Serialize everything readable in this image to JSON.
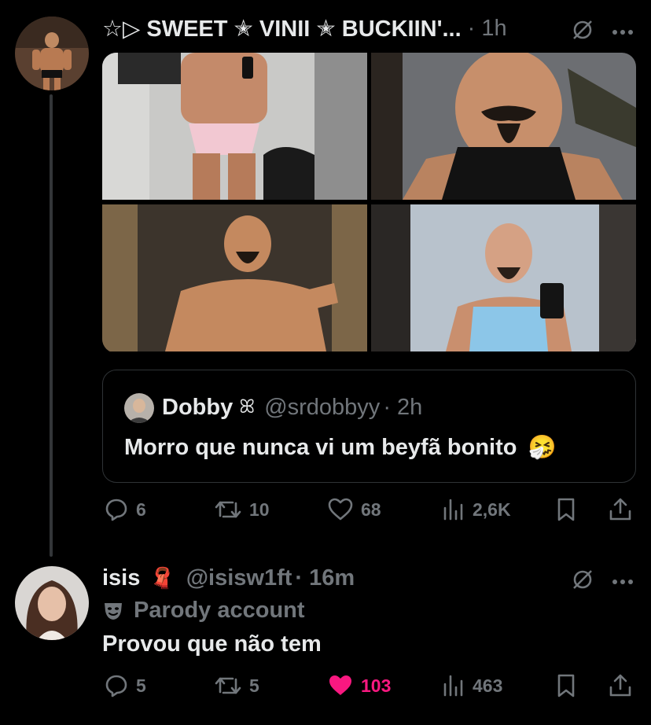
{
  "post": {
    "display_name": "☆▷ SWEET ✭ VINII ✭ BUCKIIN'...",
    "time": "· 1h",
    "media_count_alt": [
      "photo-pink-briefs-selfie",
      "photo-tank-top-goatee",
      "photo-shirtless-mirror",
      "photo-blue-tank-selfie"
    ],
    "quote": {
      "display_name": "Dobby",
      "name_emoji": "ꕤ",
      "handle": "@srdobbyy",
      "time": "· 2h",
      "text": "Morro que nunca vi um beyfã bonito",
      "emoji": "🤧"
    },
    "stats": {
      "replies": "6",
      "reposts": "10",
      "likes": "68",
      "views": "2,6K"
    }
  },
  "reply": {
    "display_name": "isis",
    "name_emoji": "🧣",
    "handle": "@isisw1ft",
    "time": "· 16m",
    "parody_label": "Parody account",
    "text": "Provou que não tem",
    "stats": {
      "replies": "5",
      "reposts": "5",
      "likes": "103",
      "views": "463"
    }
  },
  "colors": {
    "background": "#000000",
    "muted": "#71767b",
    "like_active": "#f91880",
    "border": "#2f3336"
  }
}
